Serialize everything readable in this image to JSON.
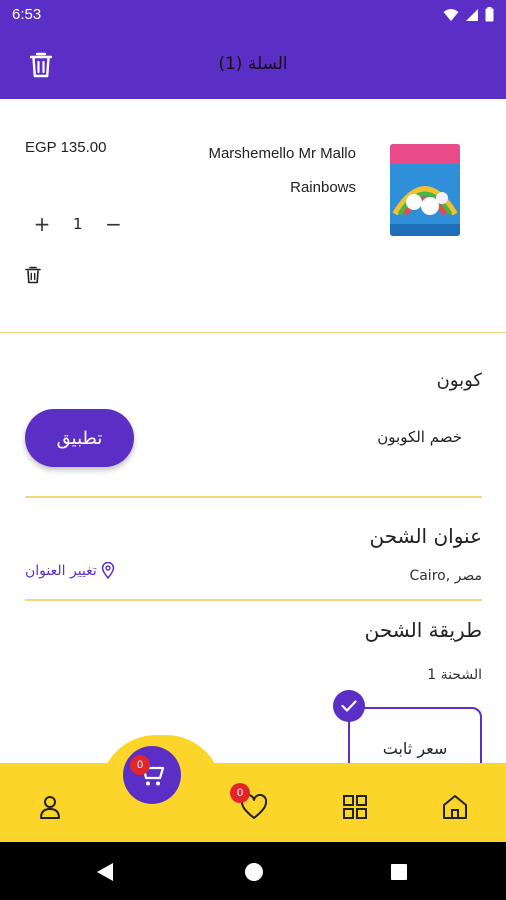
{
  "status_bar": {
    "time": "6:53"
  },
  "app_bar": {
    "title": "السلة (1)"
  },
  "cart_item": {
    "price": "EGP 135.00",
    "name": "Marshemello Mr Mallo Rainbows",
    "quantity": "1"
  },
  "coupon": {
    "title": "كوبون",
    "apply_label": "تطبيق",
    "discount_label": "خصم الكوبون"
  },
  "shipping": {
    "address_title": "عنوان الشحن",
    "change_address_label": "تغيير العنوان",
    "address_value": "Cairo, مصر",
    "method_title": "طريقة الشحن",
    "shipment_label": "الشحنة 1",
    "rate_label": "سعر ثابت"
  },
  "bottom_nav": {
    "cart_count": "0",
    "wishlist_count": "0"
  },
  "colors": {
    "primary": "#5b2fc5",
    "accent": "#fcd52a",
    "badge": "#e0262b"
  }
}
